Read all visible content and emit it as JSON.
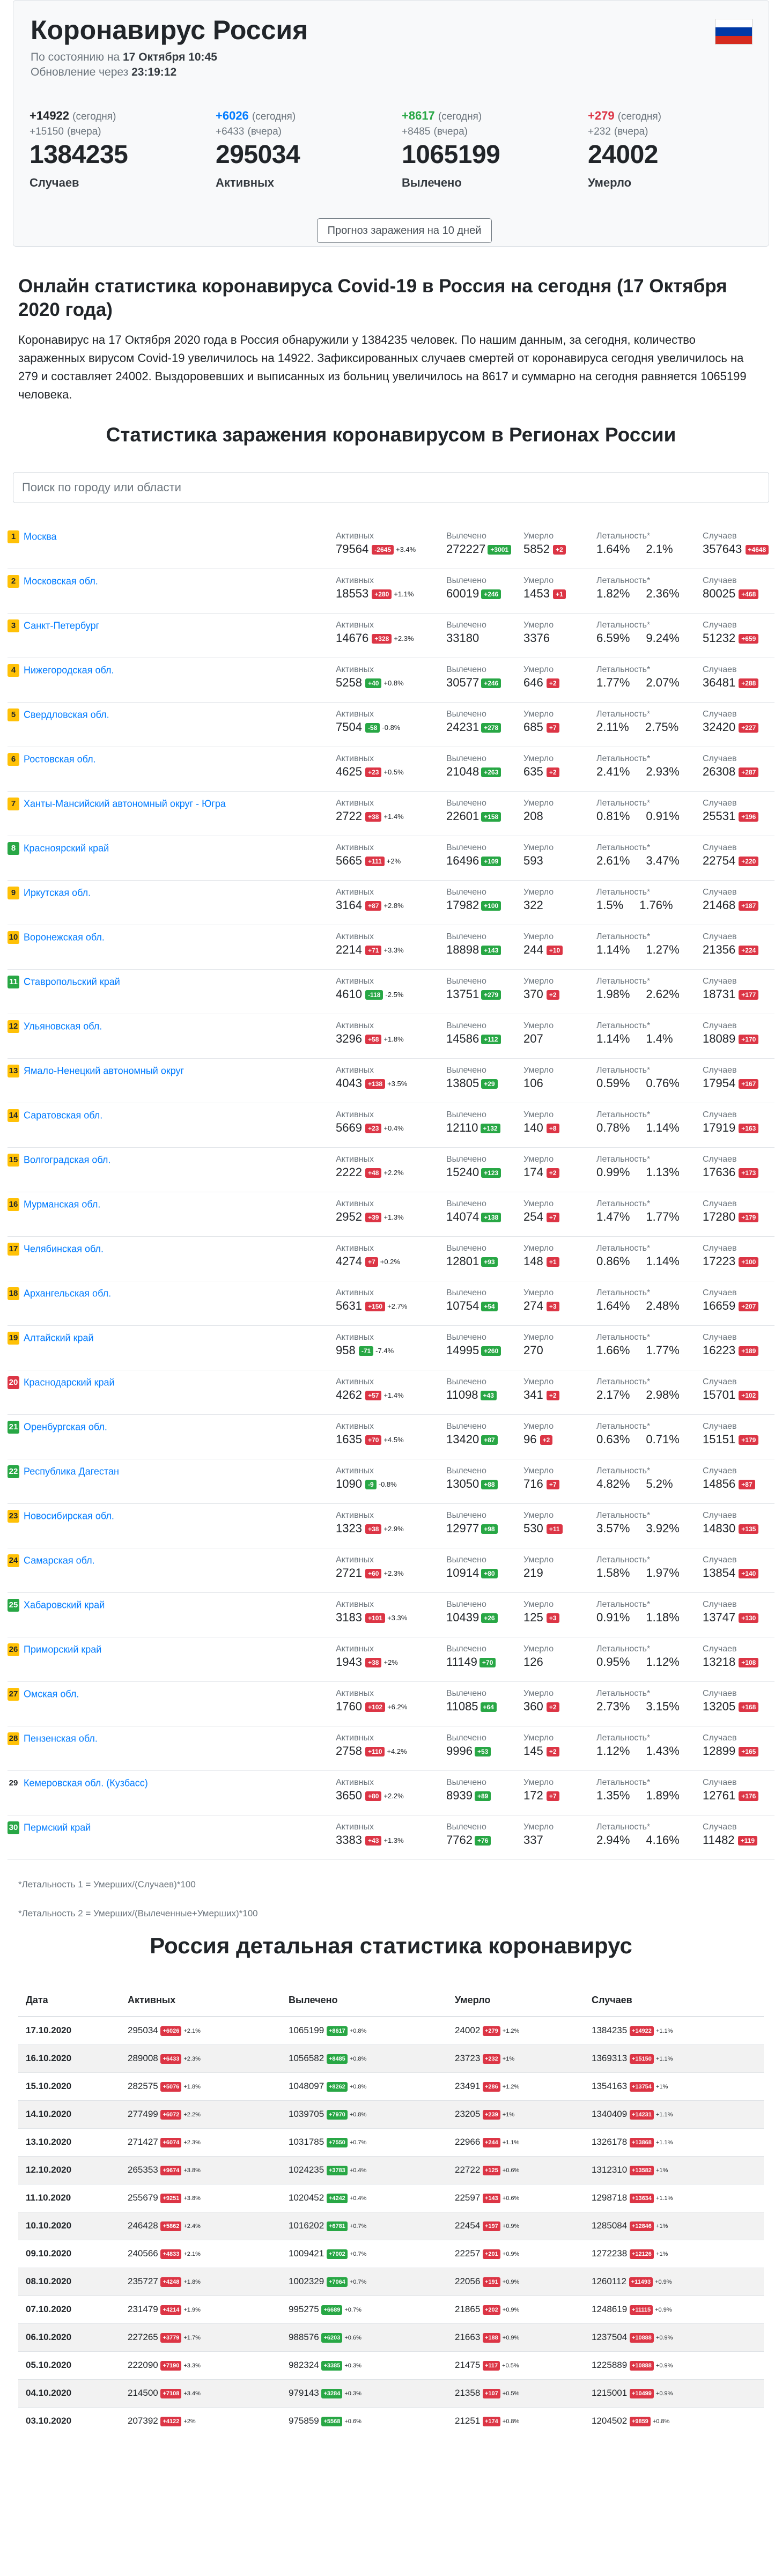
{
  "header": {
    "title": "Коронавирус Россия",
    "as_of_label": "По состоянию на",
    "as_of": "17 Октября 10:45",
    "update_label": "Обновление через",
    "update_in": "23:19:12",
    "today_word": "(сегодня)",
    "yesterday_word": "(вчера)",
    "stats": [
      {
        "today": "+14922",
        "yesterday": "+15150",
        "total": "1384235",
        "label": "Случаев",
        "color": "#212529"
      },
      {
        "today": "+6026",
        "yesterday": "+6433",
        "total": "295034",
        "label": "Активных",
        "color": "#007bff"
      },
      {
        "today": "+8617",
        "yesterday": "+8485",
        "total": "1065199",
        "label": "Вылечено",
        "color": "#28a745"
      },
      {
        "today": "+279",
        "yesterday": "+232",
        "total": "24002",
        "label": "Умерло",
        "color": "#dc3545"
      }
    ],
    "forecast_button": "Прогноз заражения на 10 дней"
  },
  "article": {
    "title": "Онлайн статистика коронавируса Covid-19 в Россия на сегодня (17 Октября 2020 года)",
    "text": "Коронавирус на 17 Октября 2020 года в Россия обнаружили у 1384235 человек. По нашим данным, за сегодня, количество зараженных вирусом Covid-19 увеличилось на 14922. Зафиксированных случаев смертей от коронавируса сегодня увеличилось на 279 и составляет 24002. Выздоровевших и выписанных из больниц увеличилось на 8617 и суммарно на сегодня равняется 1065199 человека."
  },
  "regions_title": "Статистика заражения коронавирусом в Регионах России",
  "search_placeholder": "Поиск по городу или области",
  "col_labels": {
    "active": "Активных",
    "recovered": "Вылечено",
    "deaths": "Умерло",
    "leth": "Летальность*",
    "cases": "Случаев"
  },
  "regions": [
    {
      "rank": "1",
      "rc": "y",
      "name": "Москва",
      "a": "79564",
      "ad": "-2645",
      "at": "r",
      "ap": "+3.4%",
      "r": "272227",
      "rd": "+3001",
      "d": "5852",
      "dd": "+2",
      "l1": "1.64%",
      "l2": "2.1%",
      "c": "357643",
      "cd": "+4648"
    },
    {
      "rank": "2",
      "rc": "y",
      "name": "Московская обл.",
      "a": "18553",
      "ad": "+280",
      "at": "r",
      "ap": "+1.1%",
      "r": "60019",
      "rd": "+246",
      "d": "1453",
      "dd": "+1",
      "l1": "1.82%",
      "l2": "2.36%",
      "c": "80025",
      "cd": "+468"
    },
    {
      "rank": "3",
      "rc": "y",
      "name": "Санкт-Петербург",
      "a": "14676",
      "ad": "+328",
      "at": "r",
      "ap": "+2.3%",
      "r": "33180",
      "rd": "",
      "d": "3376",
      "dd": "",
      "l1": "6.59%",
      "l2": "9.24%",
      "c": "51232",
      "cd": "+659"
    },
    {
      "rank": "4",
      "rc": "y",
      "name": "Нижегородская обл.",
      "a": "5258",
      "ad": "+40",
      "at": "g",
      "ap": "+0.8%",
      "r": "30577",
      "rd": "+246",
      "d": "646",
      "dd": "+2",
      "l1": "1.77%",
      "l2": "2.07%",
      "c": "36481",
      "cd": "+288"
    },
    {
      "rank": "5",
      "rc": "y",
      "name": "Свердловская обл.",
      "a": "7504",
      "ad": "-58",
      "at": "g",
      "ap": "-0.8%",
      "r": "24231",
      "rd": "+278",
      "d": "685",
      "dd": "+7",
      "l1": "2.11%",
      "l2": "2.75%",
      "c": "32420",
      "cd": "+227"
    },
    {
      "rank": "6",
      "rc": "y",
      "name": "Ростовская обл.",
      "a": "4625",
      "ad": "+23",
      "at": "r",
      "ap": "+0.5%",
      "r": "21048",
      "rd": "+263",
      "d": "635",
      "dd": "+2",
      "l1": "2.41%",
      "l2": "2.93%",
      "c": "26308",
      "cd": "+287"
    },
    {
      "rank": "7",
      "rc": "y",
      "name": "Ханты-Мансийский автономный округ - Югра",
      "a": "2722",
      "ad": "+38",
      "at": "r",
      "ap": "+1.4%",
      "r": "22601",
      "rd": "+158",
      "d": "208",
      "dd": "",
      "l1": "0.81%",
      "l2": "0.91%",
      "c": "25531",
      "cd": "+196"
    },
    {
      "rank": "8",
      "rc": "g",
      "name": "Красноярский край",
      "a": "5665",
      "ad": "+111",
      "at": "r",
      "ap": "+2%",
      "r": "16496",
      "rd": "+109",
      "d": "593",
      "dd": "",
      "l1": "2.61%",
      "l2": "3.47%",
      "c": "22754",
      "cd": "+220"
    },
    {
      "rank": "9",
      "rc": "y",
      "name": "Иркутская обл.",
      "a": "3164",
      "ad": "+87",
      "at": "r",
      "ap": "+2.8%",
      "r": "17982",
      "rd": "+100",
      "d": "322",
      "dd": "",
      "l1": "1.5%",
      "l2": "1.76%",
      "c": "21468",
      "cd": "+187"
    },
    {
      "rank": "10",
      "rc": "y",
      "name": "Воронежская обл.",
      "a": "2214",
      "ad": "+71",
      "at": "r",
      "ap": "+3.3%",
      "r": "18898",
      "rd": "+143",
      "d": "244",
      "dd": "+10",
      "l1": "1.14%",
      "l2": "1.27%",
      "c": "21356",
      "cd": "+224"
    },
    {
      "rank": "11",
      "rc": "g",
      "name": "Ставропольский край",
      "a": "4610",
      "ad": "-118",
      "at": "g",
      "ap": "-2.5%",
      "r": "13751",
      "rd": "+279",
      "d": "370",
      "dd": "+2",
      "l1": "1.98%",
      "l2": "2.62%",
      "c": "18731",
      "cd": "+177"
    },
    {
      "rank": "12",
      "rc": "y",
      "name": "Ульяновская обл.",
      "a": "3296",
      "ad": "+58",
      "at": "r",
      "ap": "+1.8%",
      "r": "14586",
      "rd": "+112",
      "d": "207",
      "dd": "",
      "l1": "1.14%",
      "l2": "1.4%",
      "c": "18089",
      "cd": "+170"
    },
    {
      "rank": "13",
      "rc": "y",
      "name": "Ямало-Ненецкий автономный округ",
      "a": "4043",
      "ad": "+138",
      "at": "r",
      "ap": "+3.5%",
      "r": "13805",
      "rd": "+29",
      "d": "106",
      "dd": "",
      "l1": "0.59%",
      "l2": "0.76%",
      "c": "17954",
      "cd": "+167"
    },
    {
      "rank": "14",
      "rc": "y",
      "name": "Саратовская обл.",
      "a": "5669",
      "ad": "+23",
      "at": "r",
      "ap": "+0.4%",
      "r": "12110",
      "rd": "+132",
      "d": "140",
      "dd": "+8",
      "l1": "0.78%",
      "l2": "1.14%",
      "c": "17919",
      "cd": "+163"
    },
    {
      "rank": "15",
      "rc": "y",
      "name": "Волгоградская обл.",
      "a": "2222",
      "ad": "+48",
      "at": "r",
      "ap": "+2.2%",
      "r": "15240",
      "rd": "+123",
      "d": "174",
      "dd": "+2",
      "l1": "0.99%",
      "l2": "1.13%",
      "c": "17636",
      "cd": "+173"
    },
    {
      "rank": "16",
      "rc": "y",
      "name": "Мурманская обл.",
      "a": "2952",
      "ad": "+39",
      "at": "r",
      "ap": "+1.3%",
      "r": "14074",
      "rd": "+138",
      "d": "254",
      "dd": "+7",
      "l1": "1.47%",
      "l2": "1.77%",
      "c": "17280",
      "cd": "+179"
    },
    {
      "rank": "17",
      "rc": "y",
      "name": "Челябинская обл.",
      "a": "4274",
      "ad": "+7",
      "at": "r",
      "ap": "+0.2%",
      "r": "12801",
      "rd": "+93",
      "d": "148",
      "dd": "+1",
      "l1": "0.86%",
      "l2": "1.14%",
      "c": "17223",
      "cd": "+100"
    },
    {
      "rank": "18",
      "rc": "y",
      "name": "Архангельская обл.",
      "a": "5631",
      "ad": "+150",
      "at": "r",
      "ap": "+2.7%",
      "r": "10754",
      "rd": "+54",
      "d": "274",
      "dd": "+3",
      "l1": "1.64%",
      "l2": "2.48%",
      "c": "16659",
      "cd": "+207"
    },
    {
      "rank": "19",
      "rc": "y",
      "name": "Алтайский край",
      "a": "958",
      "ad": "-71",
      "at": "g",
      "ap": "-7.4%",
      "r": "14995",
      "rd": "+260",
      "d": "270",
      "dd": "",
      "l1": "1.66%",
      "l2": "1.77%",
      "c": "16223",
      "cd": "+189"
    },
    {
      "rank": "20",
      "rc": "r",
      "name": "Краснодарский край",
      "a": "4262",
      "ad": "+57",
      "at": "r",
      "ap": "+1.4%",
      "r": "11098",
      "rd": "+43",
      "d": "341",
      "dd": "+2",
      "l1": "2.17%",
      "l2": "2.98%",
      "c": "15701",
      "cd": "+102"
    },
    {
      "rank": "21",
      "rc": "g",
      "name": "Оренбургская обл.",
      "a": "1635",
      "ad": "+70",
      "at": "r",
      "ap": "+4.5%",
      "r": "13420",
      "rd": "+87",
      "d": "96",
      "dd": "+2",
      "l1": "0.63%",
      "l2": "0.71%",
      "c": "15151",
      "cd": "+179"
    },
    {
      "rank": "22",
      "rc": "g",
      "name": "Республика Дагестан",
      "a": "1090",
      "ad": "-9",
      "at": "g",
      "ap": "-0.8%",
      "r": "13050",
      "rd": "+88",
      "d": "716",
      "dd": "+7",
      "l1": "4.82%",
      "l2": "5.2%",
      "c": "14856",
      "cd": "+87"
    },
    {
      "rank": "23",
      "rc": "y",
      "name": "Новосибирская обл.",
      "a": "1323",
      "ad": "+38",
      "at": "r",
      "ap": "+2.9%",
      "r": "12977",
      "rd": "+98",
      "d": "530",
      "dd": "+11",
      "l1": "3.57%",
      "l2": "3.92%",
      "c": "14830",
      "cd": "+135"
    },
    {
      "rank": "24",
      "rc": "y",
      "name": "Самарская обл.",
      "a": "2721",
      "ad": "+60",
      "at": "r",
      "ap": "+2.3%",
      "r": "10914",
      "rd": "+80",
      "d": "219",
      "dd": "",
      "l1": "1.58%",
      "l2": "1.97%",
      "c": "13854",
      "cd": "+140"
    },
    {
      "rank": "25",
      "rc": "g",
      "name": "Хабаровский край",
      "a": "3183",
      "ad": "+101",
      "at": "r",
      "ap": "+3.3%",
      "r": "10439",
      "rd": "+26",
      "d": "125",
      "dd": "+3",
      "l1": "0.91%",
      "l2": "1.18%",
      "c": "13747",
      "cd": "+130"
    },
    {
      "rank": "26",
      "rc": "y",
      "name": "Приморский край",
      "a": "1943",
      "ad": "+38",
      "at": "r",
      "ap": "+2%",
      "r": "11149",
      "rd": "+70",
      "d": "126",
      "dd": "",
      "l1": "0.95%",
      "l2": "1.12%",
      "c": "13218",
      "cd": "+108"
    },
    {
      "rank": "27",
      "rc": "y",
      "name": "Омская обл.",
      "a": "1760",
      "ad": "+102",
      "at": "r",
      "ap": "+6.2%",
      "r": "11085",
      "rd": "+64",
      "d": "360",
      "dd": "+2",
      "l1": "2.73%",
      "l2": "3.15%",
      "c": "13205",
      "cd": "+168"
    },
    {
      "rank": "28",
      "rc": "y",
      "name": "Пензенская обл.",
      "a": "2758",
      "ad": "+110",
      "at": "r",
      "ap": "+4.2%",
      "r": "9996",
      "rd": "+53",
      "d": "145",
      "dd": "+2",
      "l1": "1.12%",
      "l2": "1.43%",
      "c": "12899",
      "cd": "+165"
    },
    {
      "rank": "29",
      "rc": "n",
      "name": "Кемеровская обл. (Кузбасс)",
      "a": "3650",
      "ad": "+80",
      "at": "r",
      "ap": "+2.2%",
      "r": "8939",
      "rd": "+89",
      "d": "172",
      "dd": "+7",
      "l1": "1.35%",
      "l2": "1.89%",
      "c": "12761",
      "cd": "+176"
    },
    {
      "rank": "30",
      "rc": "g",
      "name": "Пермский край",
      "a": "3383",
      "ad": "+43",
      "at": "r",
      "ap": "+1.3%",
      "r": "7762",
      "rd": "+76",
      "d": "337",
      "dd": "",
      "l1": "2.94%",
      "l2": "4.16%",
      "c": "11482",
      "cd": "+119"
    }
  ],
  "notes": [
    "*Летальность 1 = Умерших/(Случаев)*100",
    "*Летальность 2 = Умерших/(Вылеченные+Умерших)*100"
  ],
  "detail_title": "Россия детальная статистика коронавирус",
  "detail_headers": [
    "Дата",
    "Активных",
    "Вылечено",
    "Умерло",
    "Случаев"
  ],
  "detail": [
    [
      "17.10.2020",
      "295034",
      "+6026",
      "+2.1%",
      "1065199",
      "+8617",
      "+0.8%",
      "24002",
      "+279",
      "+1.2%",
      "1384235",
      "+14922",
      "+1.1%"
    ],
    [
      "16.10.2020",
      "289008",
      "+6433",
      "+2.3%",
      "1056582",
      "+8485",
      "+0.8%",
      "23723",
      "+232",
      "+1%",
      "1369313",
      "+15150",
      "+1.1%"
    ],
    [
      "15.10.2020",
      "282575",
      "+5076",
      "+1.8%",
      "1048097",
      "+8262",
      "+0.8%",
      "23491",
      "+286",
      "+1.2%",
      "1354163",
      "+13754",
      "+1%"
    ],
    [
      "14.10.2020",
      "277499",
      "+6072",
      "+2.2%",
      "1039705",
      "+7970",
      "+0.8%",
      "23205",
      "+239",
      "+1%",
      "1340409",
      "+14231",
      "+1.1%"
    ],
    [
      "13.10.2020",
      "271427",
      "+6074",
      "+2.3%",
      "1031785",
      "+7550",
      "+0.7%",
      "22966",
      "+244",
      "+1.1%",
      "1326178",
      "+13868",
      "+1.1%"
    ],
    [
      "12.10.2020",
      "265353",
      "+9674",
      "+3.8%",
      "1024235",
      "+3783",
      "+0.4%",
      "22722",
      "+125",
      "+0.6%",
      "1312310",
      "+13582",
      "+1%"
    ],
    [
      "11.10.2020",
      "255679",
      "+9251",
      "+3.8%",
      "1020452",
      "+4242",
      "+0.4%",
      "22597",
      "+143",
      "+0.6%",
      "1298718",
      "+13634",
      "+1.1%"
    ],
    [
      "10.10.2020",
      "246428",
      "+5862",
      "+2.4%",
      "1016202",
      "+6781",
      "+0.7%",
      "22454",
      "+197",
      "+0.9%",
      "1285084",
      "+12846",
      "+1%"
    ],
    [
      "09.10.2020",
      "240566",
      "+4833",
      "+2.1%",
      "1009421",
      "+7002",
      "+0.7%",
      "22257",
      "+201",
      "+0.9%",
      "1272238",
      "+12126",
      "+1%"
    ],
    [
      "08.10.2020",
      "235727",
      "+4248",
      "+1.8%",
      "1002329",
      "+7064",
      "+0.7%",
      "22056",
      "+191",
      "+0.9%",
      "1260112",
      "+11493",
      "+0.9%"
    ],
    [
      "07.10.2020",
      "231479",
      "+4214",
      "+1.9%",
      "995275",
      "+6689",
      "+0.7%",
      "21865",
      "+202",
      "+0.9%",
      "1248619",
      "+11115",
      "+0.9%"
    ],
    [
      "06.10.2020",
      "227265",
      "+3779",
      "+1.7%",
      "988576",
      "+6203",
      "+0.6%",
      "21663",
      "+188",
      "+0.9%",
      "1237504",
      "+10888",
      "+0.9%"
    ],
    [
      "05.10.2020",
      "222090",
      "+7190",
      "+3.3%",
      "982324",
      "+3385",
      "+0.3%",
      "21475",
      "+117",
      "+0.5%",
      "1225889",
      "+10888",
      "+0.9%"
    ],
    [
      "04.10.2020",
      "214500",
      "+7108",
      "+3.4%",
      "979143",
      "+3284",
      "+0.3%",
      "21358",
      "+107",
      "+0.5%",
      "1215001",
      "+10499",
      "+0.9%"
    ],
    [
      "03.10.2020",
      "207392",
      "+4122",
      "+2%",
      "975859",
      "+5568",
      "+0.6%",
      "21251",
      "+174",
      "+0.8%",
      "1204502",
      "+9859",
      "+0.8%"
    ]
  ]
}
